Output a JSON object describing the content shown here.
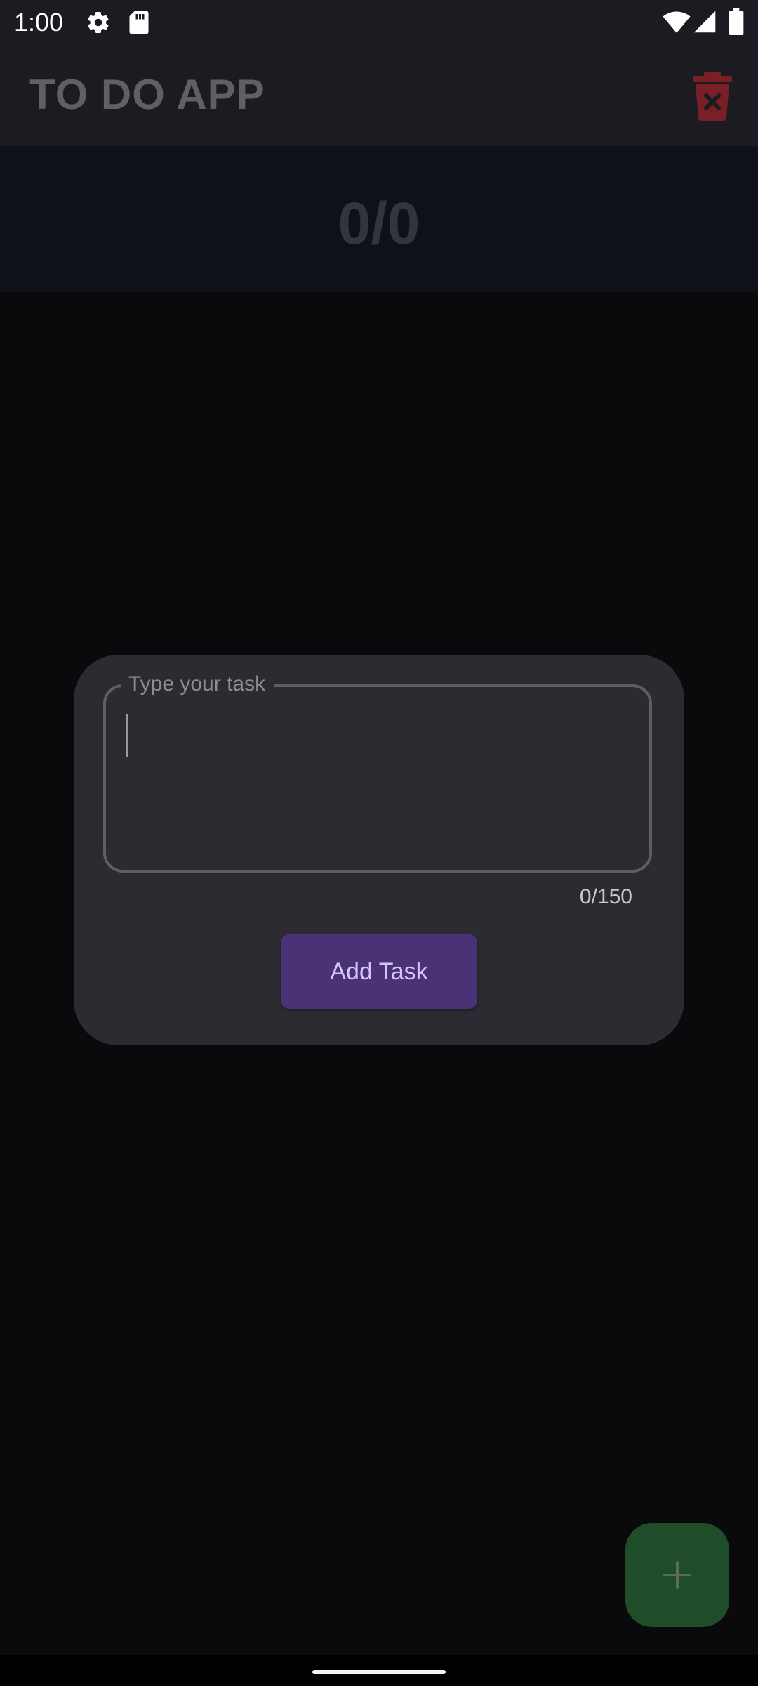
{
  "status_bar": {
    "time": "1:00",
    "icons": [
      "gear-icon",
      "sd-card-icon",
      "wifi-icon",
      "signal-icon",
      "battery-icon"
    ]
  },
  "app_bar": {
    "title": "TO DO APP",
    "delete_icon": "trash-x-icon",
    "delete_color": "#7a1f25"
  },
  "counter": {
    "text": "0/0"
  },
  "dialog": {
    "field_label": "Type your task",
    "field_value": "",
    "char_counter": "0/150",
    "button_label": "Add Task",
    "button_color": "#4a3277"
  },
  "fab": {
    "icon": "plus-icon",
    "color": "#1f4c29"
  },
  "colors": {
    "background": "#0a0a0c",
    "app_bar": "#1b1c22",
    "counter_band": "#0f1118",
    "dialog": "#2c2b31"
  }
}
